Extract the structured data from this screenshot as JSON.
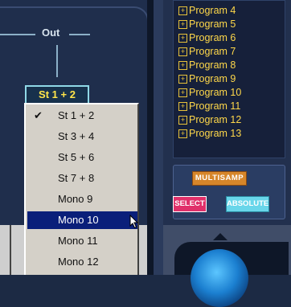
{
  "routing": {
    "out_label": "Out",
    "selected_output": "St 1 + 2"
  },
  "output_menu": {
    "items": [
      {
        "label": "St 1 + 2",
        "checked": true
      },
      {
        "label": "St 3 + 4",
        "checked": false
      },
      {
        "label": "St 5 + 6",
        "checked": false
      },
      {
        "label": "St 7 + 8",
        "checked": false
      },
      {
        "label": "Mono  9",
        "checked": false
      },
      {
        "label": "Mono 10",
        "checked": false
      },
      {
        "label": "Mono 11",
        "checked": false
      },
      {
        "label": "Mono 12",
        "checked": false
      }
    ],
    "highlighted": "Mono 10",
    "check_glyph": "✔"
  },
  "programs": {
    "items": [
      "Program 4",
      "Program 5",
      "Program 6",
      "Program 7",
      "Program 8",
      "Program 9",
      "Program 10",
      "Program 11",
      "Program 12",
      "Program 13"
    ]
  },
  "controls": {
    "multisamp_label": "MULTISAMP",
    "select_label": "SELECT",
    "absolute_label": "ABSOLUTE"
  },
  "colors": {
    "highlight": "#0a1f7a",
    "program_text": "#ffd84a",
    "multisamp": "#d6862a",
    "select": "#e0306a",
    "absolute": "#69d6ea",
    "knob": "#1b7fd0"
  }
}
